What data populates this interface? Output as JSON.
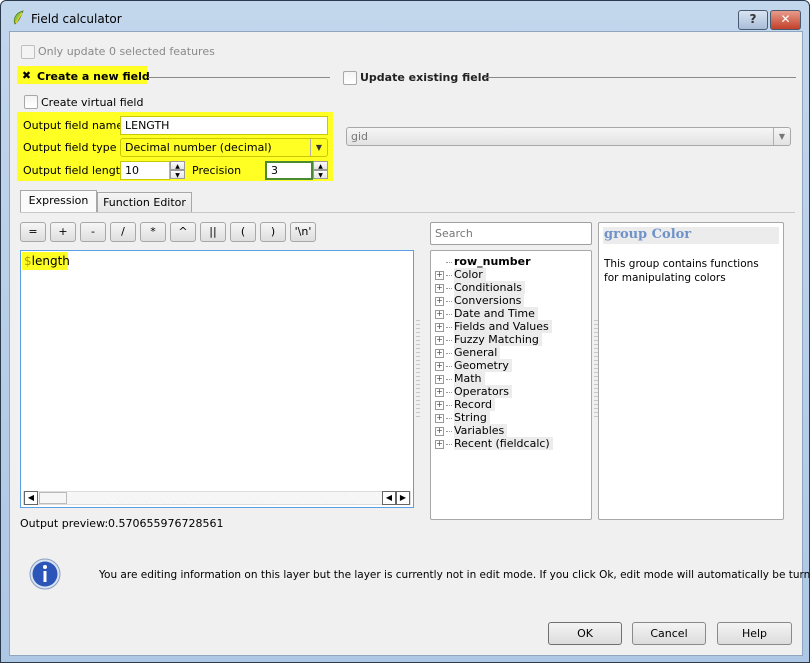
{
  "window": {
    "title": "Field calculator",
    "help_button": "?",
    "close_button": "✕"
  },
  "options": {
    "only_update_selected": "Only update 0 selected features",
    "create_new_field": "Create a new field",
    "create_new_field_checked": true,
    "update_existing_field": "Update existing field",
    "update_existing_field_checked": false,
    "create_virtual_field": "Create virtual field"
  },
  "new_field": {
    "name_label": "Output field name",
    "name_value": "LENGTH",
    "type_label": "Output field type",
    "type_value": "Decimal number (decimal)",
    "length_label": "Output field length",
    "length_value": "10",
    "precision_label": "Precision",
    "precision_value": "3"
  },
  "existing_field": {
    "selected": "gid"
  },
  "tabs": [
    {
      "label": "Expression",
      "active": true
    },
    {
      "label": "Function Editor",
      "active": false
    }
  ],
  "operators": [
    "=",
    "+",
    "-",
    "/",
    "*",
    "^",
    "||",
    "(",
    ")",
    "'\\n'"
  ],
  "expression": {
    "prefix": "$",
    "text": "length"
  },
  "functions": {
    "search_placeholder": "Search",
    "items": [
      {
        "label": "row_number",
        "bold": true,
        "expandable": false
      },
      {
        "label": "Color",
        "expandable": true
      },
      {
        "label": "Conditionals",
        "expandable": true
      },
      {
        "label": "Conversions",
        "expandable": true
      },
      {
        "label": "Date and Time",
        "expandable": true
      },
      {
        "label": "Fields and Values",
        "expandable": true
      },
      {
        "label": "Fuzzy Matching",
        "expandable": true
      },
      {
        "label": "General",
        "expandable": true
      },
      {
        "label": "Geometry",
        "expandable": true
      },
      {
        "label": "Math",
        "expandable": true
      },
      {
        "label": "Operators",
        "expandable": true
      },
      {
        "label": "Record",
        "expandable": true
      },
      {
        "label": "String",
        "expandable": true
      },
      {
        "label": "Variables",
        "expandable": true
      },
      {
        "label": "Recent (fieldcalc)",
        "expandable": true
      }
    ]
  },
  "help_panel": {
    "title": "group Color",
    "description": "This group contains functions for manipulating colors"
  },
  "preview": {
    "label": "Output preview:",
    "value": "0.570655976728561"
  },
  "info_message": "You are editing information on this layer but the layer is currently not in edit mode. If you click Ok, edit mode will automatically be turned on.",
  "buttons": {
    "ok": "OK",
    "cancel": "Cancel",
    "help": "Help"
  },
  "colors": {
    "highlight": "#ffff24",
    "help_title": "#6f93c9",
    "editor_border": "#5aa0e6"
  }
}
